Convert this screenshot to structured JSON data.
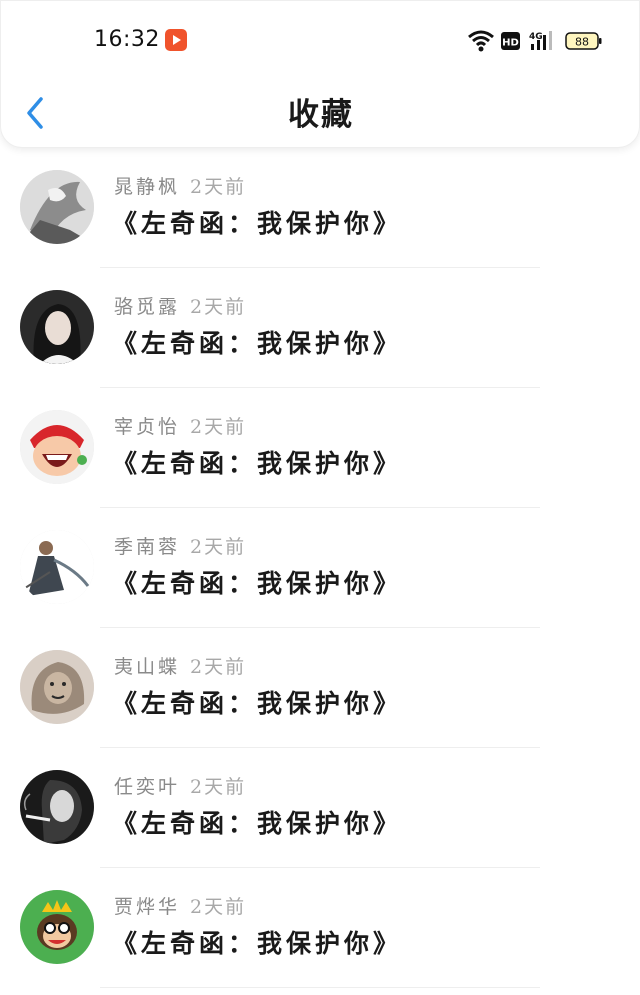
{
  "status_bar": {
    "time": "16:32",
    "battery": "88",
    "network": "4G",
    "hd": "HD"
  },
  "header": {
    "title": "收藏"
  },
  "items": [
    {
      "name": "晁静枫",
      "time": "2天前",
      "work": "《左奇函：我保护你》",
      "avatar": "avatar-warrior-sketch"
    },
    {
      "name": "骆觅露",
      "time": "2天前",
      "work": "《左奇函：我保护你》",
      "avatar": "avatar-girl-photo"
    },
    {
      "name": "宰贞怡",
      "time": "2天前",
      "work": "《左奇函：我保护你》",
      "avatar": "avatar-laughing-cartoon"
    },
    {
      "name": "季南蓉",
      "time": "2天前",
      "work": "《左奇函：我保护你》",
      "avatar": "avatar-cloaked-figure"
    },
    {
      "name": "夷山蝶",
      "time": "2天前",
      "work": "《左奇函：我保护你》",
      "avatar": "avatar-lion-sketch"
    },
    {
      "name": "任奕叶",
      "time": "2天前",
      "work": "《左奇函：我保护你》",
      "avatar": "avatar-smoking-bw"
    },
    {
      "name": "贾烨华",
      "time": "2天前",
      "work": "《左奇函：我保护你》",
      "avatar": "avatar-monkey-crown"
    }
  ]
}
